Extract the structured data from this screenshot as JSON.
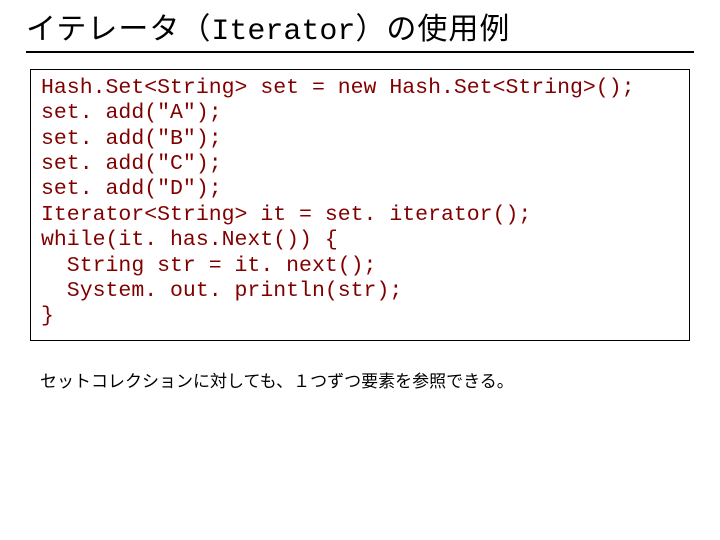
{
  "title": {
    "pre": "イテレータ（",
    "mono": "Iterator",
    "post": "）の使用例"
  },
  "code": "Hash.Set<String> set = new Hash.Set<String>();\nset. add(\"A\");\nset. add(\"B\");\nset. add(\"C\");\nset. add(\"D\");\nIterator<String> it = set. iterator();\nwhile(it. has.Next()) {\n  String str = it. next();\n  System. out. println(str);\n}",
  "caption": "セットコレクションに対しても、１つずつ要素を参照できる。"
}
